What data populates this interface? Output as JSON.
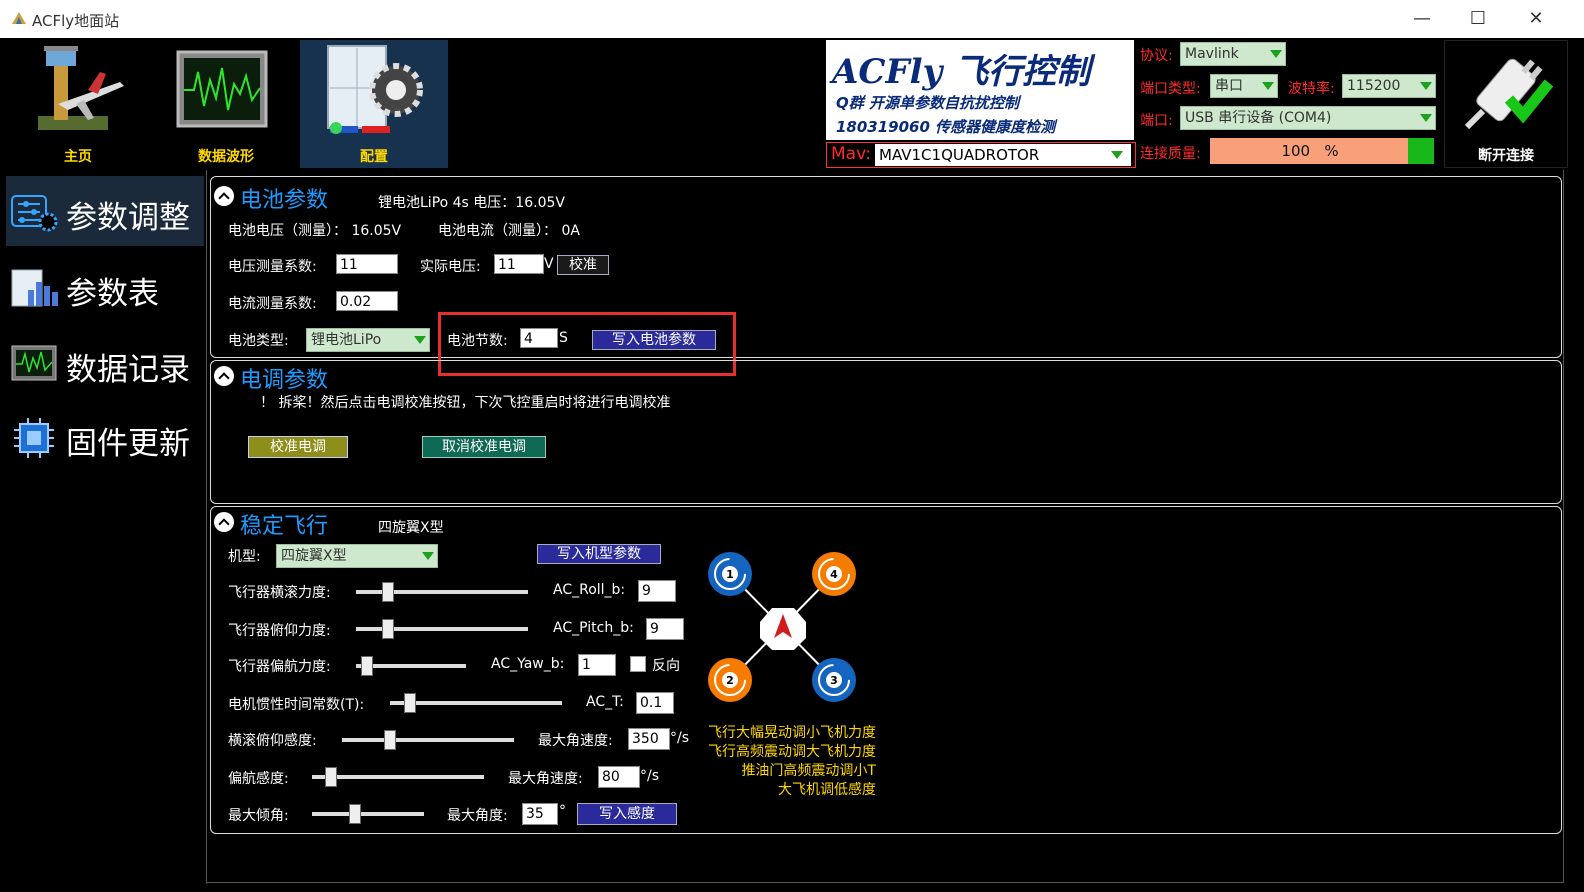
{
  "window": {
    "title": "ACFly地面站",
    "minimize": "—",
    "maximize": "☐",
    "close": "✕"
  },
  "toolbar": {
    "home_label": "主页",
    "waveform_label": "数据波形",
    "config_label": "配置"
  },
  "connection": {
    "protocol_label": "协议:",
    "protocol_value": "Mavlink",
    "port_type_label": "端口类型:",
    "port_type_value": "串口",
    "baud_label": "波特率:",
    "baud_value": "115200",
    "port_label": "端口:",
    "port_value": "USB 串行设备 (COM4)",
    "mav_label": "Mav:",
    "mav_value": "MAV1C1QUADROTOR",
    "quality_label": "连接质量:",
    "quality_text": "100   %",
    "quality_fraction": 1.0,
    "disconnect_label": "断开连接"
  },
  "brand": {
    "line1": "ACFly 飞行控制",
    "line2": "Q群   开源单参数自抗扰控制",
    "line3": "180319060 传感器健康度检测"
  },
  "sidebar": {
    "items": [
      {
        "label": "参数调整"
      },
      {
        "label": "参数表"
      },
      {
        "label": "数据记录"
      },
      {
        "label": "固件更新"
      }
    ]
  },
  "battery": {
    "title": "电池参数",
    "summary": "锂电池LiPo 4s   电压：16.05V",
    "measured_voltage": "电池电压（测量）：  16.05V",
    "measured_current": "电池电流（测量）：  0A",
    "voltage_coef_label": "电压测量系数:",
    "voltage_coef_value": "11",
    "actual_voltage_label": "实际电压:",
    "actual_voltage_value": "11",
    "actual_voltage_unit": "V",
    "calibrate_label": "校准",
    "current_coef_label": "电流测量系数:",
    "current_coef_value": "0.02",
    "type_label": "电池类型:",
    "type_value": "锂电池LiPo",
    "cells_label": "电池节数:",
    "cells_value": "4",
    "cells_unit": "S",
    "write_label": "写入电池参数"
  },
  "esc": {
    "title": "电调参数",
    "note": "！ 拆桨！然后点击电调校准按钮，下次飞控重启时将进行电调校准",
    "calibrate_label": "校准电调",
    "cancel_label": "取消校准电调"
  },
  "stable": {
    "title": "稳定飞行",
    "frame_summary": "四旋翼X型",
    "frame_label": "机型:",
    "frame_value": "四旋翼X型",
    "write_frame_label": "写入机型参数",
    "roll_label": "飞行器横滚力度:",
    "roll_param_label": "AC_Roll_b:",
    "roll_value": "9",
    "pitch_label": "飞行器俯仰力度:",
    "pitch_param_label": "AC_Pitch_b:",
    "pitch_value": "9",
    "yaw_label": "飞行器偏航力度:",
    "yaw_param_label": "AC_Yaw_b:",
    "yaw_value": "1",
    "reverse_label": "反向",
    "tau_label": "电机惯性时间常数(T):",
    "tau_param_label": "AC_T:",
    "tau_value": "0.1",
    "rp_sens_label": "横滚俯仰感度:",
    "rp_max_rate_label": "最大角速度:",
    "rp_max_rate_value": "350",
    "rp_unit": "°/s",
    "yaw_sens_label": "偏航感度:",
    "yaw_max_rate_label": "最大角速度:",
    "yaw_max_rate_value": "80",
    "yaw_unit": "°/s",
    "tilt_label": "最大倾角:",
    "max_angle_label": "最大角度:",
    "max_angle_value": "35",
    "angle_unit": "°",
    "write_sens_label": "写入感度",
    "tips": [
      "飞行大幅晃动调小飞机力度",
      "飞行高频震动调大飞机力度",
      "推油门高频震动调小T",
      "大飞机调低感度"
    ],
    "motors": [
      "1",
      "2",
      "3",
      "4"
    ],
    "colors": {
      "cw": "#1565c0",
      "ccw": "#f57c00"
    }
  }
}
